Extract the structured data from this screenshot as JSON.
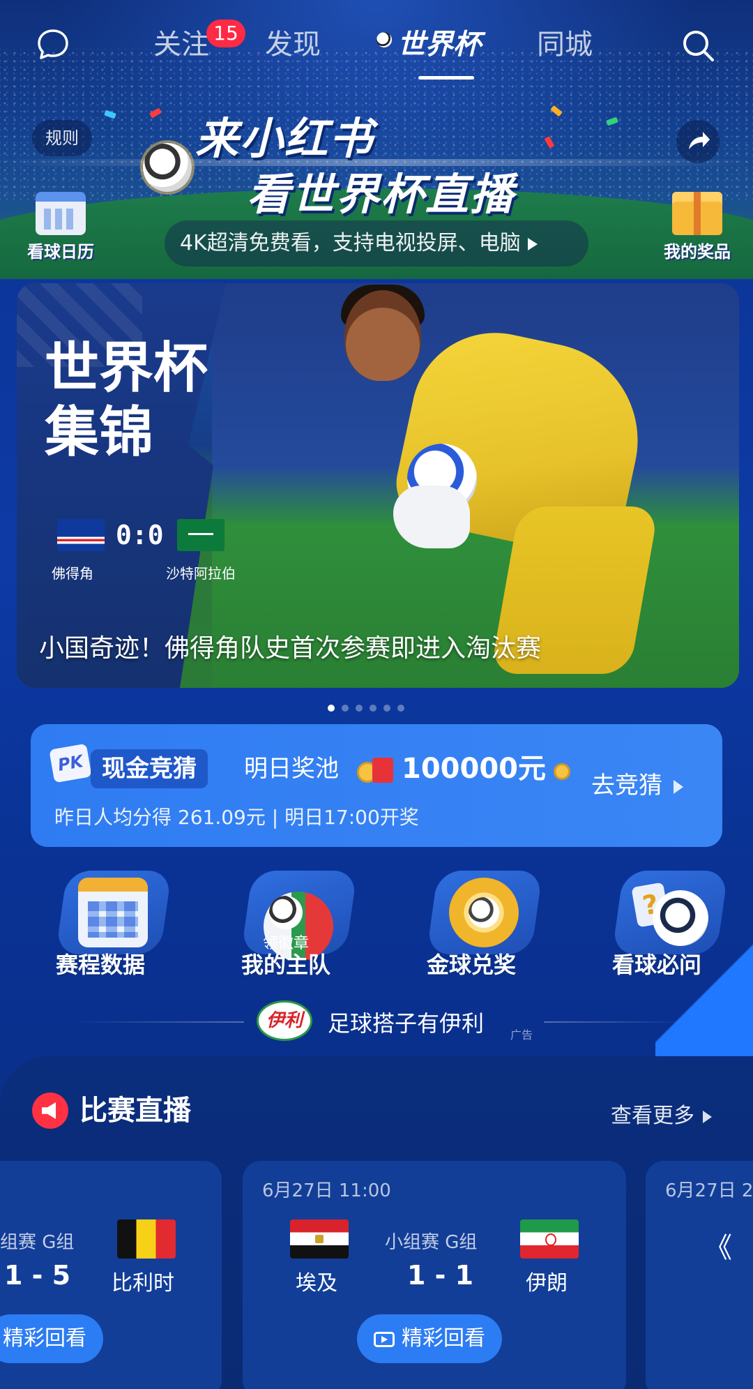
{
  "nav": {
    "tabs": [
      {
        "label": "关注",
        "badge": "15"
      },
      {
        "label": "发现"
      },
      {
        "label": "世界杯"
      },
      {
        "label": "同城"
      }
    ]
  },
  "hero": {
    "rules_label": "规则",
    "title_line1": "来小红书",
    "title_line2": "看世界杯直播",
    "subtitle": "4K超清免费看，支持电视投屏、电脑",
    "calendar_label": "看球日历",
    "prize_label": "我的奖品"
  },
  "highlight": {
    "title_line1": "世界杯",
    "title_line2": "集锦",
    "home_team": "佛得角",
    "away_team": "沙特阿拉伯",
    "score": "0:0",
    "caption": "小国奇迹！佛得角队史首次参赛即进入淘汰赛",
    "slides_total": 6,
    "slides_active": 1
  },
  "guess": {
    "pk_icon": "PK",
    "tag": "现金竞猜",
    "pool_label": "明日奖池",
    "amount": "100000元",
    "go_label": "去竞猜",
    "sub": "昨日人均分得 261.09元 | 明日17:00开奖"
  },
  "quick": {
    "items": [
      {
        "label": "赛程数据",
        "icon": "calendar-icon"
      },
      {
        "label": "我的主队",
        "sub": "领徽章",
        "icon": "team-badge-icon"
      },
      {
        "label": "金球兑奖",
        "icon": "golden-ball-icon"
      },
      {
        "label": "看球必问",
        "icon": "question-ball-icon"
      }
    ]
  },
  "ad": {
    "logo_text": "伊利",
    "text": "足球搭子有伊利",
    "tag": "广告"
  },
  "live": {
    "title": "比赛直播",
    "more": "查看更多",
    "matches": [
      {
        "stage": "组赛 G组",
        "score": "1 - 5",
        "away": "比利时",
        "replay": "精彩回看"
      },
      {
        "time": "6月27日 11:00",
        "stage": "小组赛 G组",
        "home": "埃及",
        "away": "伊朗",
        "score": "1 - 1",
        "replay": "精彩回看"
      },
      {
        "time": "6月27日 2"
      }
    ]
  },
  "colors": {
    "badge": "#ff2a44",
    "accent": "#2c7cf3",
    "live_red": "#ff3143"
  }
}
